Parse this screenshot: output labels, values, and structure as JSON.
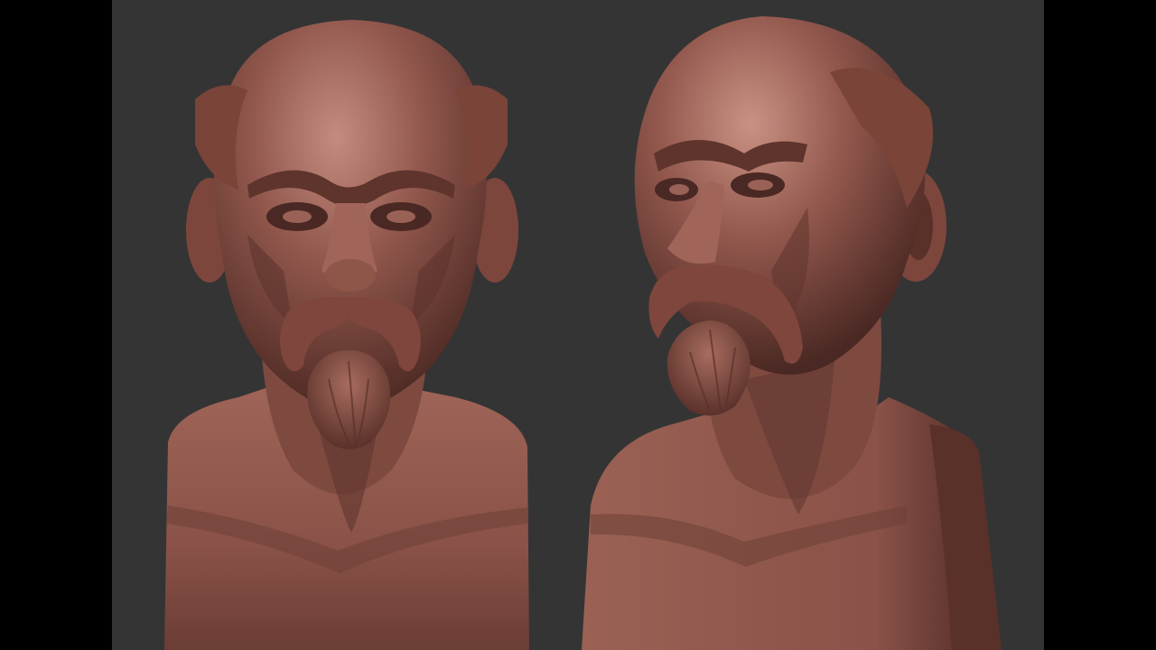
{
  "image": {
    "subject": "sculpt render",
    "views": [
      "front-view",
      "three-quarter-view"
    ]
  },
  "colors": {
    "letterbox": "#000000",
    "viewport_background": "#343434",
    "clay_base": "#8a5248",
    "clay_highlight": "#c99184",
    "clay_shadow": "#4a2823",
    "clay_dark": "#2e1714"
  }
}
